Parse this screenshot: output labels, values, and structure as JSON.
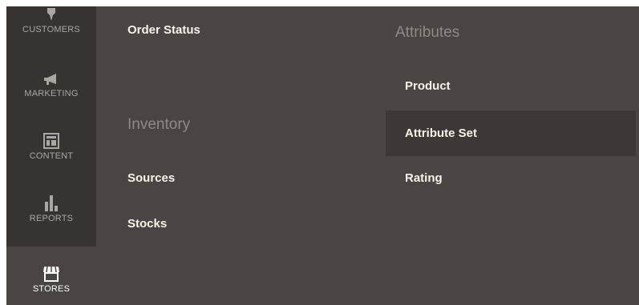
{
  "sidebar": {
    "items": [
      {
        "label": "CUSTOMERS",
        "icon": "customers-icon"
      },
      {
        "label": "MARKETING",
        "icon": "megaphone-icon"
      },
      {
        "label": "CONTENT",
        "icon": "layout-icon"
      },
      {
        "label": "REPORTS",
        "icon": "bar-chart-icon"
      },
      {
        "label": "STORES",
        "icon": "storefront-icon",
        "active": true
      }
    ]
  },
  "submenu": {
    "col1": {
      "order_status": "Order Status",
      "inventory_heading": "Inventory",
      "sources": "Sources",
      "stocks": "Stocks"
    },
    "col2": {
      "attributes_heading": "Attributes",
      "product": "Product",
      "attribute_set": "Attribute Set",
      "rating": "Rating"
    }
  },
  "colors": {
    "sidebar_bg": "#373330",
    "panel_bg": "#4a4542",
    "highlight_bg": "#3d3835",
    "heading": "#8f8a84",
    "link": "#f7f3eb"
  }
}
